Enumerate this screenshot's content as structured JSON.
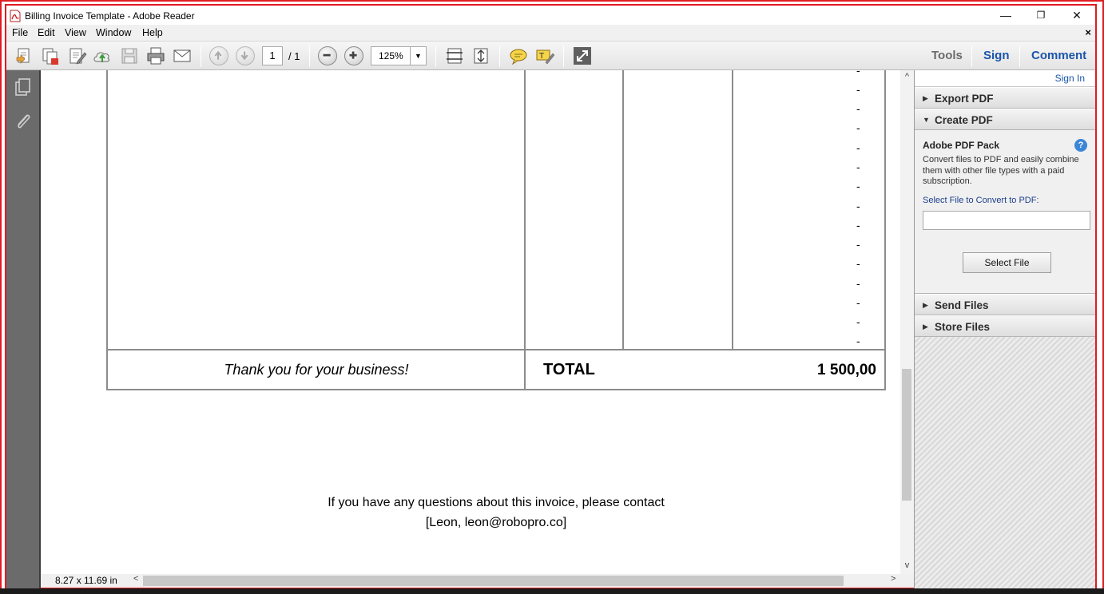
{
  "window": {
    "title": "Billing Invoice Template - Adobe Reader",
    "minimize": "—",
    "restore": "❐",
    "close": "✕"
  },
  "menu": {
    "items": [
      {
        "label": "File"
      },
      {
        "label": "Edit"
      },
      {
        "label": "View"
      },
      {
        "label": "Window"
      },
      {
        "label": "Help"
      }
    ],
    "close_doc": "×"
  },
  "toolbar": {
    "page_current": "1",
    "page_total": "/ 1",
    "zoom": "125%",
    "zoom_arrow": "▼",
    "tools": "Tools",
    "sign": "Sign",
    "comment": "Comment",
    "icons": [
      "create-pdf-icon",
      "combine-icon",
      "edit-icon",
      "upload-icon",
      "save-icon",
      "print-icon",
      "email-icon",
      "prev-page-icon",
      "next-page-icon",
      "zoom-out-icon",
      "zoom-in-icon",
      "fit-width-icon",
      "fit-page-icon",
      "comment-icon",
      "highlight-icon",
      "fullscreen-icon"
    ]
  },
  "document": {
    "dashes": [
      "-",
      "-",
      "-",
      "-",
      "-",
      "-",
      "-",
      "-",
      "-",
      "-",
      "-",
      "-",
      "-",
      "-",
      "-"
    ],
    "thanks": "Thank you for your business!",
    "total_label": "TOTAL",
    "total_value": "1 500,00",
    "contact_line1": "If you have any questions about this invoice, please contact",
    "contact_line2": "[Leon, leon@robopro.co]"
  },
  "status": {
    "page_size": "8.27 x 11.69 in",
    "left_arrow": "<",
    "right_arrow": ">",
    "up_arrow": "^",
    "down_arrow": "v"
  },
  "right_pane": {
    "sign_in": "Sign In",
    "export_pdf": "Export PDF",
    "create_pdf": "Create PDF",
    "pack_title": "Adobe PDF Pack",
    "pack_desc": "Convert files to PDF and easily combine them with other file types with a paid subscription.",
    "select_label": "Select File to Convert to PDF:",
    "select_button": "Select File",
    "send_files": "Send Files",
    "store_files": "Store Files",
    "help": "?",
    "collapsed_marker": "▶",
    "expanded_marker": "▼"
  },
  "colors": {
    "accent_link": "#1a55a8",
    "frame_highlight": "#e01b24",
    "nav_panel": "#6b6b6b"
  }
}
